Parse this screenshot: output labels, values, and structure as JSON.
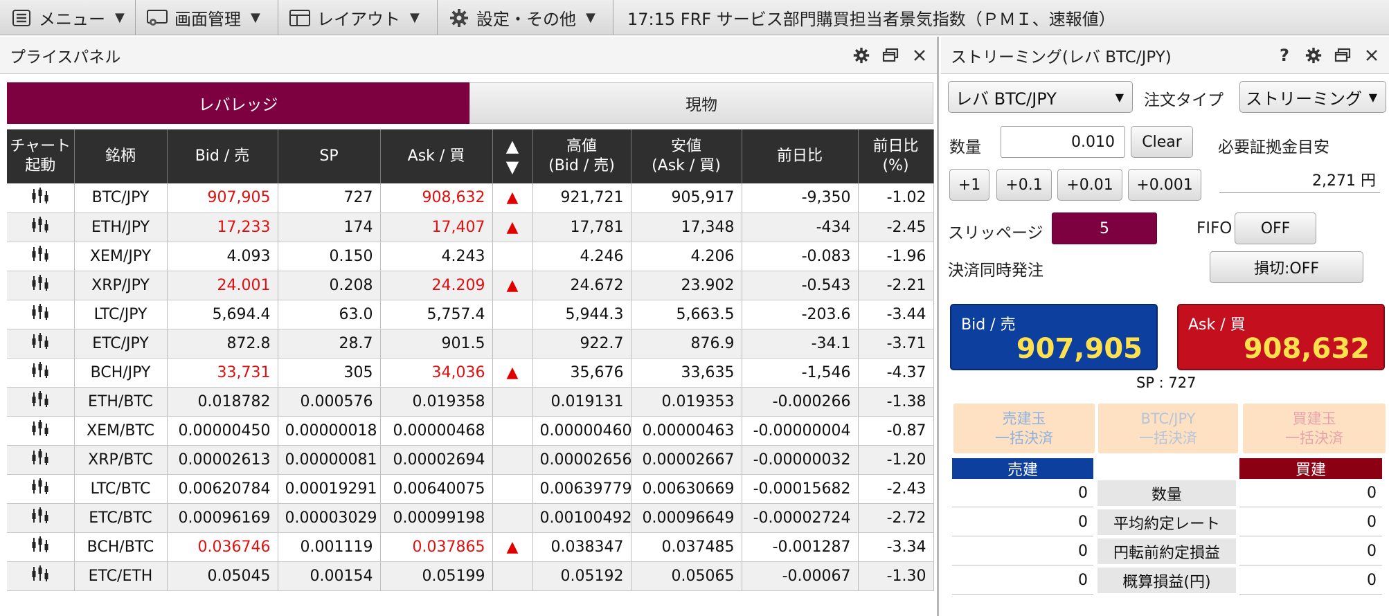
{
  "menubar": {
    "items": [
      {
        "label": "メニュー"
      },
      {
        "label": "画面管理"
      },
      {
        "label": "レイアウト"
      },
      {
        "label": "設定・その他"
      }
    ],
    "ticker": "17:15  FRF  サービス部門購買担当者景気指数（ＰＭＩ、速報値）"
  },
  "price_panel": {
    "title": "プライスパネル",
    "tabs": [
      {
        "label": "レバレッジ"
      },
      {
        "label": "現物"
      }
    ],
    "headers": {
      "chart": "チャート起動",
      "chart_l1": "チャート",
      "chart_l2": "起動",
      "symbol": "銘柄",
      "bid": "Bid / 売",
      "sp": "SP",
      "ask": "Ask / 買",
      "sort_up": "▲",
      "sort_down": "▼",
      "high_l1": "高値",
      "high_l2": "(Bid / 売)",
      "low_l1": "安値",
      "low_l2": "(Ask / 買)",
      "change": "前日比",
      "pct_l1": "前日比",
      "pct_l2": "(%)"
    },
    "rows": [
      {
        "symbol": "BTC/JPY",
        "bid": "907,905",
        "sp": "727",
        "ask": "908,632",
        "arrow": "▲",
        "high": "921,721",
        "low": "905,917",
        "change": "-9,350",
        "pct": "-1.02",
        "highlight": true
      },
      {
        "symbol": "ETH/JPY",
        "bid": "17,233",
        "sp": "174",
        "ask": "17,407",
        "arrow": "▲",
        "high": "17,781",
        "low": "17,348",
        "change": "-434",
        "pct": "-2.45",
        "highlight": true
      },
      {
        "symbol": "XEM/JPY",
        "bid": "4.093",
        "sp": "0.150",
        "ask": "4.243",
        "arrow": "",
        "high": "4.246",
        "low": "4.206",
        "change": "-0.083",
        "pct": "-1.96",
        "highlight": false
      },
      {
        "symbol": "XRP/JPY",
        "bid": "24.001",
        "sp": "0.208",
        "ask": "24.209",
        "arrow": "▲",
        "high": "24.672",
        "low": "23.902",
        "change": "-0.543",
        "pct": "-2.21",
        "highlight": true
      },
      {
        "symbol": "LTC/JPY",
        "bid": "5,694.4",
        "sp": "63.0",
        "ask": "5,757.4",
        "arrow": "",
        "high": "5,944.3",
        "low": "5,663.5",
        "change": "-203.6",
        "pct": "-3.44",
        "highlight": false
      },
      {
        "symbol": "ETC/JPY",
        "bid": "872.8",
        "sp": "28.7",
        "ask": "901.5",
        "arrow": "",
        "high": "922.7",
        "low": "876.9",
        "change": "-34.1",
        "pct": "-3.71",
        "highlight": false
      },
      {
        "symbol": "BCH/JPY",
        "bid": "33,731",
        "sp": "305",
        "ask": "34,036",
        "arrow": "▲",
        "high": "35,676",
        "low": "33,635",
        "change": "-1,546",
        "pct": "-4.37",
        "highlight": true
      },
      {
        "symbol": "ETH/BTC",
        "bid": "0.018782",
        "sp": "0.000576",
        "ask": "0.019358",
        "arrow": "",
        "high": "0.019131",
        "low": "0.019353",
        "change": "-0.000266",
        "pct": "-1.38",
        "highlight": false
      },
      {
        "symbol": "XEM/BTC",
        "bid": "0.00000450",
        "sp": "0.00000018",
        "ask": "0.00000468",
        "arrow": "",
        "high": "0.00000460",
        "low": "0.00000463",
        "change": "-0.00000004",
        "pct": "-0.87",
        "highlight": false
      },
      {
        "symbol": "XRP/BTC",
        "bid": "0.00002613",
        "sp": "0.00000081",
        "ask": "0.00002694",
        "arrow": "",
        "high": "0.00002656",
        "low": "0.00002667",
        "change": "-0.00000032",
        "pct": "-1.20",
        "highlight": false
      },
      {
        "symbol": "LTC/BTC",
        "bid": "0.00620784",
        "sp": "0.00019291",
        "ask": "0.00640075",
        "arrow": "",
        "high": "0.00639779",
        "low": "0.00630669",
        "change": "-0.00015682",
        "pct": "-2.43",
        "highlight": false
      },
      {
        "symbol": "ETC/BTC",
        "bid": "0.00096169",
        "sp": "0.00003029",
        "ask": "0.00099198",
        "arrow": "",
        "high": "0.00100492",
        "low": "0.00096649",
        "change": "-0.00002724",
        "pct": "-2.72",
        "highlight": false
      },
      {
        "symbol": "BCH/BTC",
        "bid": "0.036746",
        "sp": "0.001119",
        "ask": "0.037865",
        "arrow": "▲",
        "high": "0.038347",
        "low": "0.037485",
        "change": "-0.001287",
        "pct": "-3.34",
        "highlight": true
      },
      {
        "symbol": "ETC/ETH",
        "bid": "0.05045",
        "sp": "0.00154",
        "ask": "0.05199",
        "arrow": "",
        "high": "0.05192",
        "low": "0.05065",
        "change": "-0.00067",
        "pct": "-1.30",
        "highlight": false
      }
    ]
  },
  "streaming": {
    "title": "ストリーミング(レバ BTC/JPY)",
    "help": "?",
    "symbol_select": "レバ BTC/JPY",
    "order_type_label": "注文タイプ",
    "order_type_value": "ストリーミング",
    "qty_label": "数量",
    "qty_value": "0.010",
    "clear_label": "Clear",
    "margin_label": "必要証拠金目安",
    "margin_value": "2,271 円",
    "increments": [
      "+1",
      "+0.1",
      "+0.01",
      "+0.001"
    ],
    "slippage_label": "スリッページ",
    "slippage_value": "5",
    "fifo_label": "FIFO",
    "fifo_value": "OFF",
    "simul_label": "決済同時発注",
    "stoploss_label": "損切:OFF",
    "bid_label": "Bid / 売",
    "bid_value": "907,905",
    "ask_label": "Ask / 買",
    "ask_value": "908,632",
    "sp_text": "SP : 727",
    "bulk": [
      {
        "l1": "売建玉",
        "l2": "一括決済"
      },
      {
        "l1": "BTC/JPY",
        "l2": "一括決済"
      },
      {
        "l1": "買建玉",
        "l2": "一括決済"
      }
    ],
    "sell_header": "売建",
    "buy_header": "買建",
    "position_rows": [
      {
        "label": "数量",
        "sell": "0",
        "buy": "0"
      },
      {
        "label": "平均約定レート",
        "sell": "0",
        "buy": "0"
      },
      {
        "label": "円転前約定損益",
        "sell": "0",
        "buy": "0"
      },
      {
        "label": "概算損益(円)",
        "sell": "0",
        "buy": "0"
      }
    ]
  },
  "colors": {
    "accent": "#7d0040",
    "bid": "#0d3f9e",
    "ask": "#c4101e",
    "price_value": "#ffe14d",
    "up_red": "#e01010"
  }
}
